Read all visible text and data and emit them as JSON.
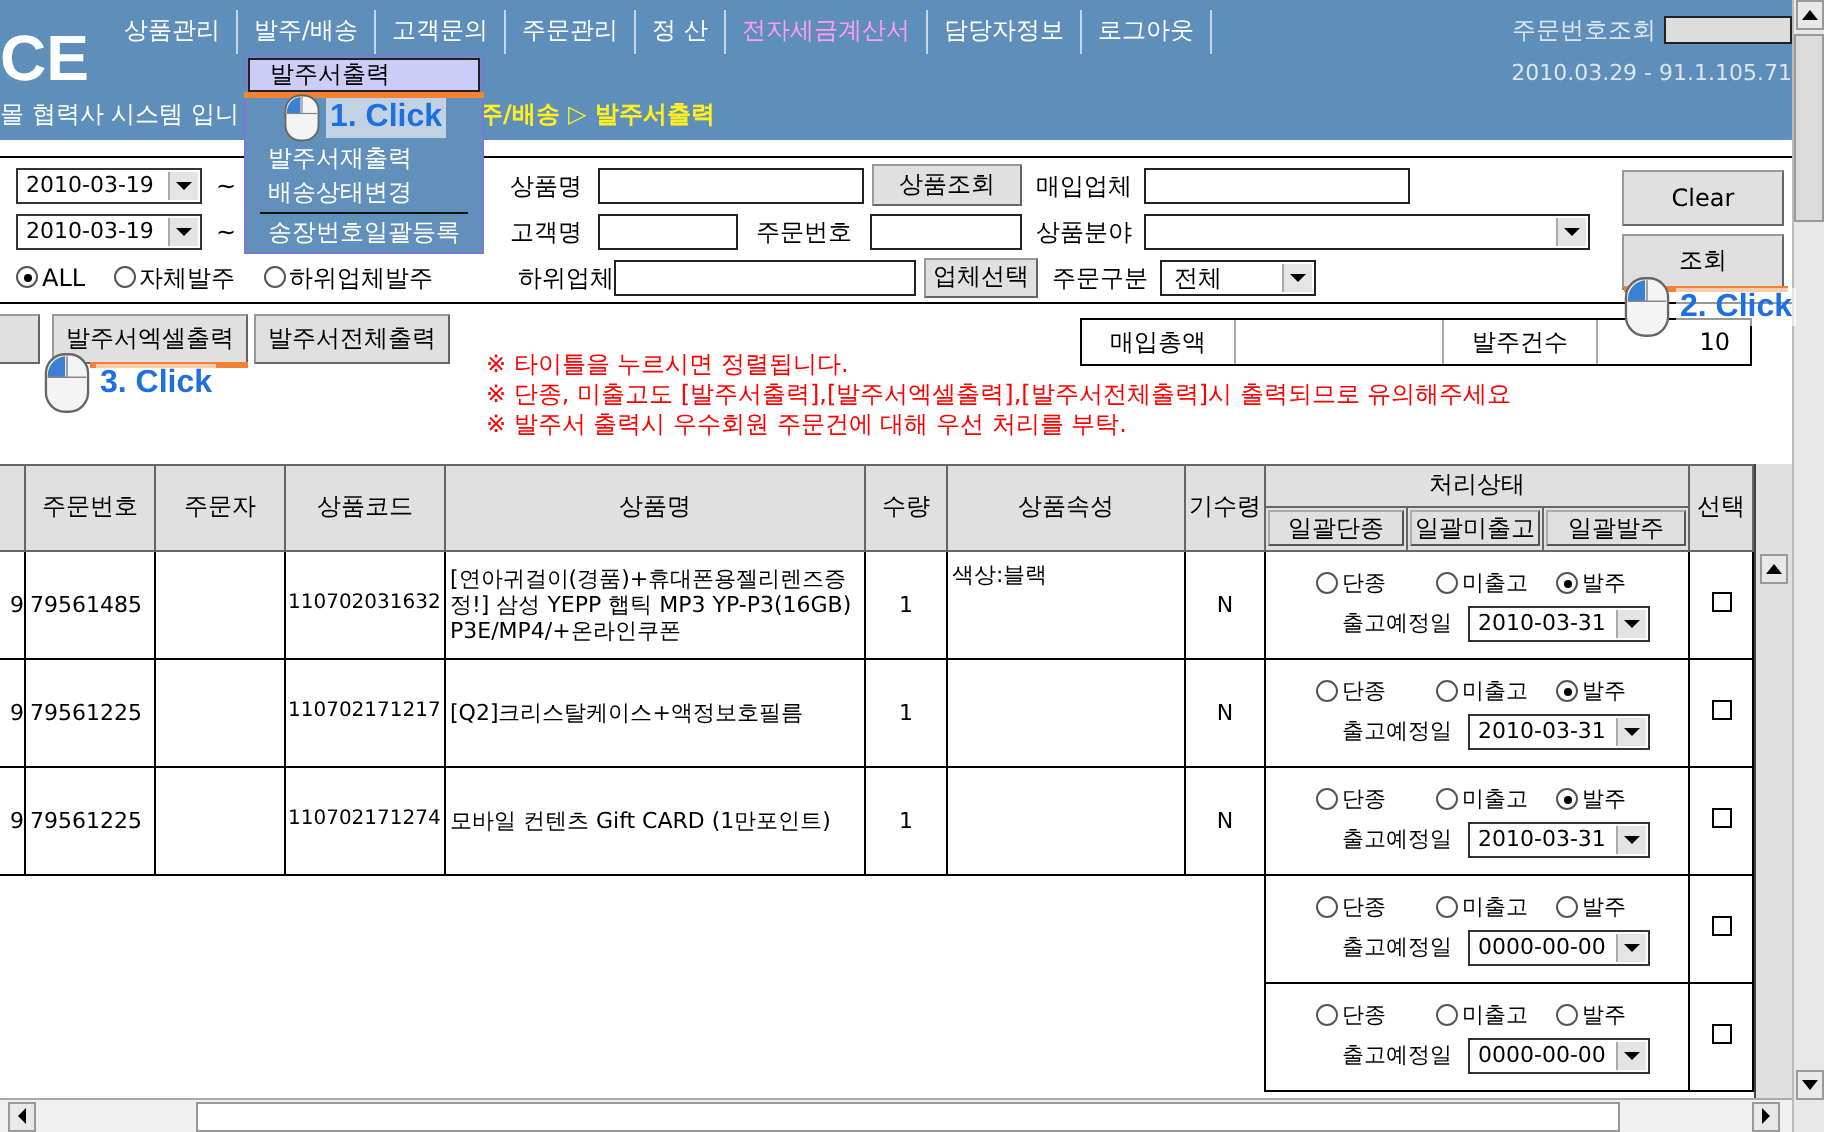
{
  "header": {
    "logo": "CE",
    "nav": [
      {
        "label": "상품관리",
        "highlight": false
      },
      {
        "label": "발주/배송",
        "highlight": false
      },
      {
        "label": "고객문의",
        "highlight": false
      },
      {
        "label": "주문관리",
        "highlight": false
      },
      {
        "label": "정  산",
        "highlight": false
      },
      {
        "label": "전자세금계산서",
        "highlight": true
      },
      {
        "label": "담당자정보",
        "highlight": false
      },
      {
        "label": "로그아웃",
        "highlight": false
      }
    ],
    "order_lookup_label": "주문번호조회",
    "session_info": "2010.03.29 - 91.1.105.71",
    "breadcrumb_prefix": "몰 협력사 시스템 입니",
    "breadcrumb": "주/배송 ▷ 발주서출력"
  },
  "menu": {
    "items": [
      {
        "label": "발주서출력",
        "selected": true,
        "separator_after": false
      },
      {
        "label": "발주서재출력",
        "selected": false,
        "separator_after": false
      },
      {
        "label": "배송상태변경",
        "selected": false,
        "separator_after": true
      },
      {
        "label": "송장번호일괄등록",
        "selected": false,
        "separator_after": false
      }
    ]
  },
  "search": {
    "date_rows": [
      {
        "date": "2010-03-19",
        "separator": "~"
      },
      {
        "date": "2010-03-19",
        "separator": "~"
      }
    ],
    "product_name_label": "상품명",
    "product_search_button": "상품조회",
    "vendor_label": "매입업체",
    "customer_label": "고객명",
    "order_no_label": "주문번호",
    "category_label": "상품분야",
    "scope_radios": [
      {
        "label": "ALL",
        "selected": true
      },
      {
        "label": "자체발주",
        "selected": false
      },
      {
        "label": "하위업체발주",
        "selected": false
      }
    ],
    "sub_vendor_label": "하위업체",
    "vendor_select_button": "업체선택",
    "order_type_label": "주문구분",
    "order_type_value": "전체",
    "clear_button": "Clear",
    "search_button": "조회"
  },
  "actions": {
    "buttons": [
      "발주서엑셀출력",
      "발주서전체출력"
    ]
  },
  "summary": {
    "purchase_total_label": "매입총액",
    "order_count_label": "발주건수",
    "order_count": "10"
  },
  "notes": [
    "※ 타이틀을 누르시면 정렬됩니다.",
    "※ 단종, 미출고도 [발주서출력],[발주서엑셀출력],[발주서전체출력]시 출력되므로 유의해주세요",
    "※ 발주서 출력시 우수회원 주문건에 대해 우선 처리를 부탁."
  ],
  "callouts": [
    {
      "text": "1. Click"
    },
    {
      "text": "2. Click"
    },
    {
      "text": "3. Click"
    }
  ],
  "table": {
    "columns": [
      "주문번호",
      "주문자",
      "상품코드",
      "상품명",
      "수량",
      "상품속성",
      "기수령",
      "처리상태",
      "선택"
    ],
    "status_buttons": [
      "일괄단종",
      "일괄미출고",
      "일괄발주"
    ],
    "rows": [
      {
        "kind": "order",
        "column_1": "9",
        "order_no": "79561485",
        "product_code": "110702031632",
        "product_name": "[연아귀걸이(경품)+휴대폰용젤리렌즈증정!]  삼성 YEPP 햅틱 MP3 YP-P3(16GB) P3E/MP4/+온라인쿠폰",
        "quantity": "1",
        "attribute": "색상:블랙",
        "received": "N",
        "status": [
          {
            "label": "단종",
            "selected": false
          },
          {
            "label": "미출고",
            "selected": false
          },
          {
            "label": "발주",
            "selected": true
          }
        ],
        "ship_label": "출고예정일",
        "ship_date": "2010-03-31",
        "checked": false
      },
      {
        "kind": "order",
        "column_1": "9",
        "order_no": "79561225",
        "product_code": "110702171217",
        "product_name": "[Q2]크리스탈케이스+액정보호필름",
        "quantity": "1",
        "received": "N",
        "status": [
          {
            "label": "단종",
            "selected": false
          },
          {
            "label": "미출고",
            "selected": false
          },
          {
            "label": "발주",
            "selected": true
          }
        ],
        "ship_label": "출고예정일",
        "ship_date": "2010-03-31",
        "checked": false
      },
      {
        "kind": "order",
        "column_1": "9",
        "order_no": "79561225",
        "product_code": "110702171274",
        "product_name": "모바일 컨텐츠 Gift CARD (1만포인트)",
        "quantity": "1",
        "received": "N",
        "status": [
          {
            "label": "단종",
            "selected": false
          },
          {
            "label": "미출고",
            "selected": false
          },
          {
            "label": "발주",
            "selected": true
          }
        ],
        "ship_label": "출고예정일",
        "ship_date": "2010-03-31",
        "checked": false
      },
      {
        "kind": "blank",
        "status": [
          {
            "label": "단종",
            "selected": false
          },
          {
            "label": "미출고",
            "selected": false
          },
          {
            "label": "발주",
            "selected": false
          }
        ],
        "ship_label": "출고예정일",
        "ship_date": "0000-00-00",
        "checked": false
      },
      {
        "kind": "blank",
        "status": [
          {
            "label": "단종",
            "selected": false
          },
          {
            "label": "미출고",
            "selected": false
          },
          {
            "label": "발주",
            "selected": false
          }
        ],
        "ship_label": "출고예정일",
        "ship_date": "0000-00-00",
        "checked": false
      }
    ]
  }
}
